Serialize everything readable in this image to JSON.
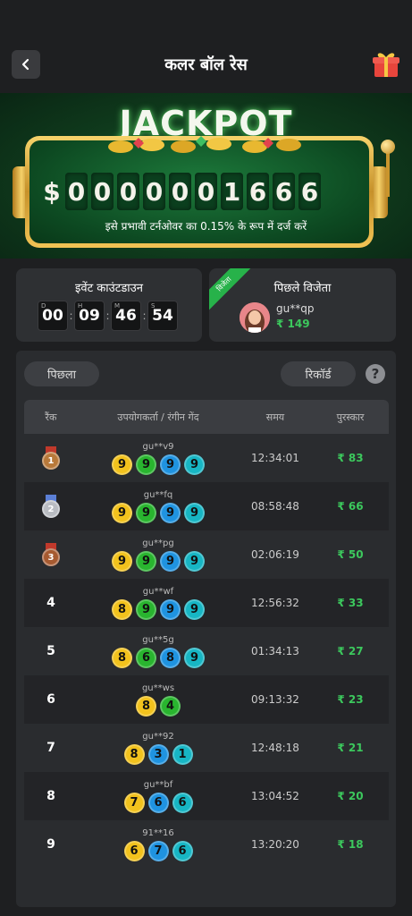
{
  "header": {
    "title": "कलर बॉल रेस",
    "back_icon": "chevron-left-icon",
    "gift_icon": "gift-icon"
  },
  "jackpot": {
    "heading": "JACKPOT",
    "currency": "$",
    "digits": [
      "0",
      "0",
      "0",
      "0",
      "0",
      "0",
      "1",
      "6",
      "6",
      "6"
    ],
    "note": "इसे प्रभावी टर्नओवर का 0.15% के रूप में दर्ज करें"
  },
  "countdown": {
    "title": "इवेंट काउंटडाउन",
    "units": [
      "D",
      "H",
      "M",
      "S"
    ],
    "values": [
      "00",
      "09",
      "46",
      "54"
    ]
  },
  "last_winner": {
    "title": "पिछले विजेता",
    "badge": "विजेता",
    "name": "gu**qp",
    "prize": "₹ 149"
  },
  "records": {
    "prev_label": "पिछला",
    "record_label": "रिकॉर्ड",
    "help": "?",
    "columns": {
      "rank": "रैंक",
      "user": "उपयोगकर्ता / रंगीन गेंद",
      "time": "समय",
      "prize": "पुरस्कार"
    },
    "rows": [
      {
        "rank": "1",
        "medal": "bronze",
        "user": "gu**v9",
        "balls": [
          [
            "9",
            "yellow"
          ],
          [
            "9",
            "green"
          ],
          [
            "9",
            "blue"
          ],
          [
            "9",
            "teal"
          ]
        ],
        "time": "12:34:01",
        "prize": "₹ 83"
      },
      {
        "rank": "2",
        "medal": "silver",
        "user": "gu**fq",
        "balls": [
          [
            "9",
            "yellow"
          ],
          [
            "9",
            "green"
          ],
          [
            "9",
            "blue"
          ],
          [
            "9",
            "teal"
          ]
        ],
        "time": "08:58:48",
        "prize": "₹ 66"
      },
      {
        "rank": "3",
        "medal": "copper",
        "user": "gu**pg",
        "balls": [
          [
            "9",
            "yellow"
          ],
          [
            "9",
            "green"
          ],
          [
            "9",
            "blue"
          ],
          [
            "9",
            "teal"
          ]
        ],
        "time": "02:06:19",
        "prize": "₹ 50"
      },
      {
        "rank": "4",
        "user": "gu**wf",
        "balls": [
          [
            "8",
            "yellow"
          ],
          [
            "9",
            "green"
          ],
          [
            "9",
            "blue"
          ],
          [
            "9",
            "teal"
          ]
        ],
        "time": "12:56:32",
        "prize": "₹ 33"
      },
      {
        "rank": "5",
        "user": "gu**5g",
        "balls": [
          [
            "8",
            "yellow"
          ],
          [
            "6",
            "green"
          ],
          [
            "8",
            "blue"
          ],
          [
            "9",
            "teal"
          ]
        ],
        "time": "01:34:13",
        "prize": "₹ 27"
      },
      {
        "rank": "6",
        "user": "gu**ws",
        "balls": [
          [
            "8",
            "yellow"
          ],
          [
            "4",
            "green"
          ]
        ],
        "time": "09:13:32",
        "prize": "₹ 23"
      },
      {
        "rank": "7",
        "user": "gu**92",
        "balls": [
          [
            "8",
            "yellow"
          ],
          [
            "3",
            "blue"
          ],
          [
            "1",
            "teal"
          ]
        ],
        "time": "12:48:18",
        "prize": "₹ 21"
      },
      {
        "rank": "8",
        "user": "gu**bf",
        "balls": [
          [
            "7",
            "yellow"
          ],
          [
            "6",
            "blue"
          ],
          [
            "6",
            "teal"
          ]
        ],
        "time": "13:04:52",
        "prize": "₹ 20"
      },
      {
        "rank": "9",
        "user": "91**16",
        "balls": [
          [
            "6",
            "yellow"
          ],
          [
            "7",
            "blue"
          ],
          [
            "6",
            "teal"
          ]
        ],
        "time": "13:20:20",
        "prize": "₹ 18"
      }
    ]
  },
  "colors": {
    "yellow": "#f2c21d",
    "green": "#29b52f",
    "blue": "#1f93e0",
    "teal": "#17b6c4",
    "prize_green": "#3cc85d",
    "bronze": "#b8793a",
    "silver": "#b9bcc2",
    "copper": "#a65a30"
  }
}
